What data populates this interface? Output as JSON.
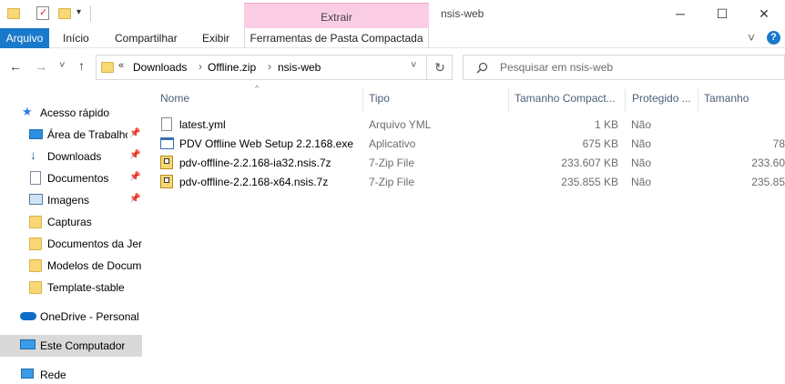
{
  "window": {
    "title": "nsis-web",
    "contextual_tab_group": "Extrair",
    "controls": {
      "minimize": "─",
      "maximize": "☐",
      "close": "✕"
    }
  },
  "ribbon": {
    "tabs": [
      "Arquivo",
      "Início",
      "Compartilhar",
      "Exibir",
      "Ferramentas de Pasta Compactada"
    ],
    "collapse_icon": "˅",
    "help_icon": "?"
  },
  "address": {
    "overflow": "«",
    "crumbs": [
      "Downloads",
      "Offline.zip",
      "nsis-web"
    ],
    "separator": "›",
    "dropdown": "˅"
  },
  "search": {
    "placeholder": "Pesquisar em nsis-web"
  },
  "nav_buttons": {
    "back": "←",
    "forward": "→",
    "recent": "˅",
    "up": "↑",
    "refresh": "↻"
  },
  "sidebar": {
    "items": [
      {
        "label": "Acesso rápido",
        "icon": "star-icon",
        "pinned": false
      },
      {
        "label": "Área de Trabalho",
        "icon": "desktop-icon",
        "pinned": true
      },
      {
        "label": "Downloads",
        "icon": "download-icon",
        "pinned": true
      },
      {
        "label": "Documentos",
        "icon": "documents-icon",
        "pinned": true
      },
      {
        "label": "Imagens",
        "icon": "pictures-icon",
        "pinned": true
      },
      {
        "label": "Capturas",
        "icon": "folder-icon",
        "pinned": false
      },
      {
        "label": "Documentos da Jen",
        "icon": "folder-icon",
        "pinned": false
      },
      {
        "label": "Modelos de Docum",
        "icon": "folder-icon",
        "pinned": false
      },
      {
        "label": "Template-stable",
        "icon": "folder-icon",
        "pinned": false
      },
      {
        "label": "OneDrive - Personal",
        "icon": "cloud-icon",
        "pinned": false
      },
      {
        "label": "Este Computador",
        "icon": "computer-icon",
        "pinned": false
      },
      {
        "label": "Rede",
        "icon": "network-icon",
        "pinned": false
      }
    ],
    "pin_icon": "📌"
  },
  "columns": [
    "Nome",
    "Tipo",
    "Tamanho Compact...",
    "Protegido ...",
    "Tamanho"
  ],
  "files": [
    {
      "name": "latest.yml",
      "type": "Arquivo YML",
      "compressed_size": "1 KB",
      "protected": "Não",
      "size": "",
      "icon": "text-file-icon"
    },
    {
      "name": "PDV Offline Web Setup 2.2.168.exe",
      "type": "Aplicativo",
      "compressed_size": "675 KB",
      "protected": "Não",
      "size": "78",
      "icon": "exe-file-icon"
    },
    {
      "name": "pdv-offline-2.2.168-ia32.nsis.7z",
      "type": "7-Zip File",
      "compressed_size": "233.607 KB",
      "protected": "Não",
      "size": "233.60",
      "icon": "archive-file-icon"
    },
    {
      "name": "pdv-offline-2.2.168-x64.nsis.7z",
      "type": "7-Zip File",
      "compressed_size": "235.855 KB",
      "protected": "Não",
      "size": "235.85",
      "icon": "archive-file-icon"
    }
  ],
  "colors": {
    "accent": "#1979ca",
    "contextual_tab": "#fbcde4",
    "selected_nav": "#d9d9d9",
    "folder": "#f8d775"
  }
}
